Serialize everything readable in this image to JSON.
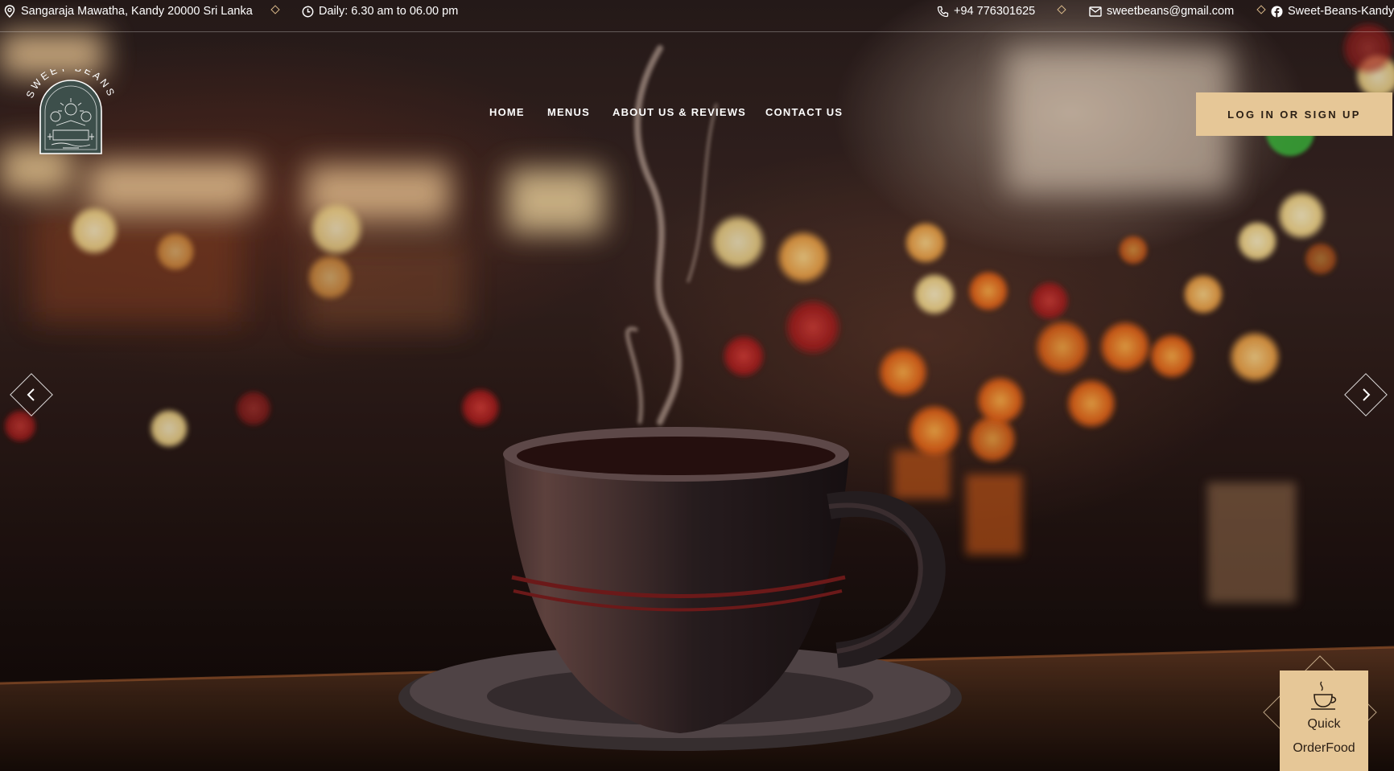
{
  "topbar": {
    "address": "Sangaraja Mawatha, Kandy 20000 Sri Lanka",
    "hours": "Daily: 6.30 am to 06.00 pm",
    "phone": "+94 776301625",
    "email": "sweetbeans@gmail.com",
    "facebook": "Sweet-Beans-Kandy"
  },
  "brand": {
    "logo_text": "SWEET BEANS",
    "accent_color": "#e6c797",
    "logo_color": "#3d4f4b"
  },
  "nav": {
    "items": [
      "HOME",
      "MENUS",
      "ABOUT US & REVIEWS",
      "CONTACT US"
    ]
  },
  "header": {
    "login_label": "LOG IN OR SIGN UP"
  },
  "slider": {
    "prev_icon": "chevron-left-icon",
    "next_icon": "chevron-right-icon"
  },
  "quick_order": {
    "line1": "Quick",
    "line2": "OrderFood",
    "icon": "coffee-cup-icon"
  }
}
